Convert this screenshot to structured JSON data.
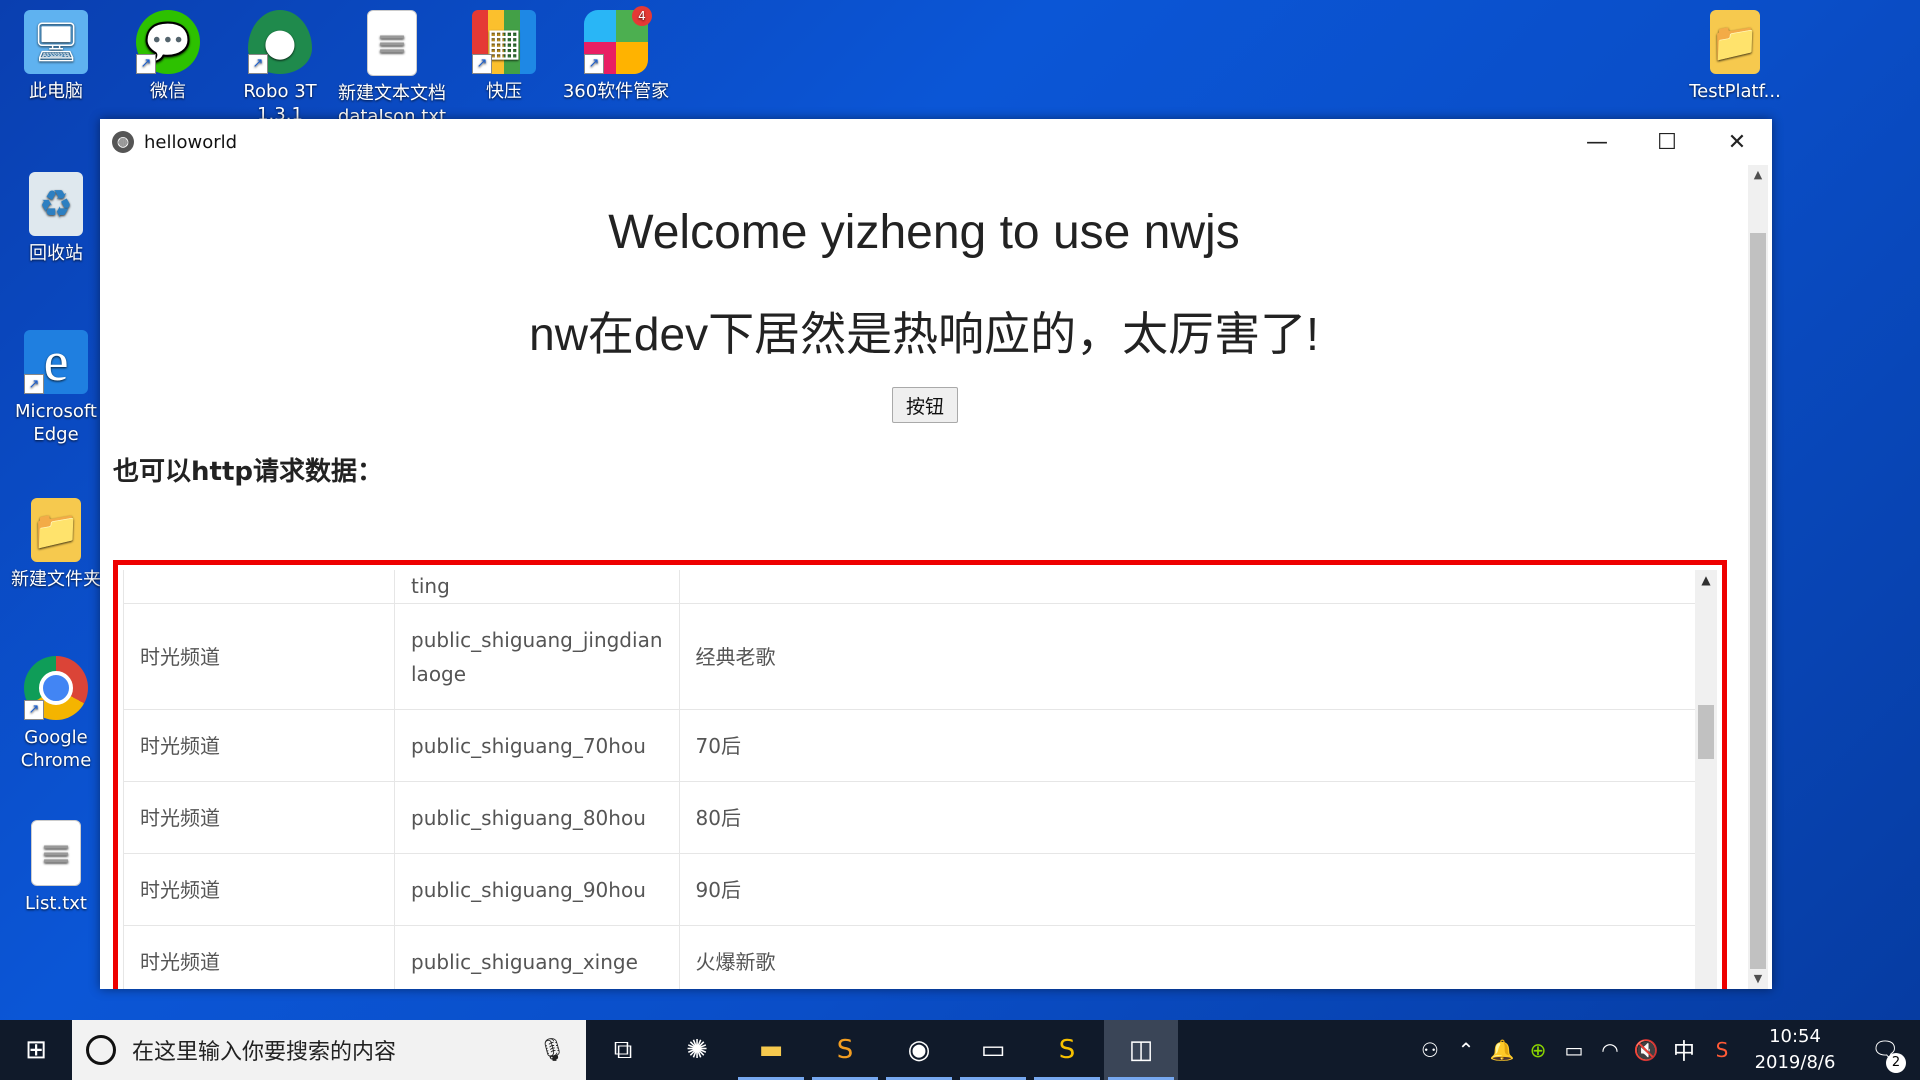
{
  "desktop": {
    "icons": [
      {
        "label": "此电脑"
      },
      {
        "label": "微信"
      },
      {
        "label": "Robo 3T 1.3.1"
      },
      {
        "label": "新建文本文档 dataJson.txt"
      },
      {
        "label": "快压"
      },
      {
        "label": "360软件管家",
        "badge": "4"
      },
      {
        "label": "TestPlatf..."
      },
      {
        "label": "回收站"
      },
      {
        "label": "Microsoft Edge"
      },
      {
        "label": "新建文件夹"
      },
      {
        "label": "Google Chrome"
      },
      {
        "label": "List.txt"
      }
    ]
  },
  "window": {
    "title": "helloworld",
    "minimize": "—",
    "maximize": "☐",
    "close": "✕"
  },
  "page": {
    "heading": "Welcome yizheng to use nwjs",
    "subheading": "nw在dev下居然是热响应的，太厉害了!",
    "button_label": "按钮",
    "section_title": "也可以http请求数据："
  },
  "table": {
    "partial_row": {
      "col1": "",
      "col2": "ting",
      "col3": ""
    },
    "rows": [
      {
        "col1": "时光频道",
        "col2": "public_shiguang_jingdian laoge",
        "col3": "经典老歌"
      },
      {
        "col1": "时光频道",
        "col2": "public_shiguang_70hou",
        "col3": "70后"
      },
      {
        "col1": "时光频道",
        "col2": "public_shiguang_80hou",
        "col3": "80后"
      },
      {
        "col1": "时光频道",
        "col2": "public_shiguang_90hou",
        "col3": "90后"
      },
      {
        "col1": "时光频道",
        "col2": "public_shiguang_xinge",
        "col3": "火爆新歌"
      }
    ]
  },
  "taskbar": {
    "search_placeholder": "在这里输入你要搜索的内容",
    "ime": "中",
    "time": "10:54",
    "date": "2019/8/6",
    "notification_count": "2"
  },
  "colors": {
    "frame_highlight": "#ee0000",
    "desktop_bg": "#0b56d6",
    "taskbar_bg": "#101a2a"
  }
}
